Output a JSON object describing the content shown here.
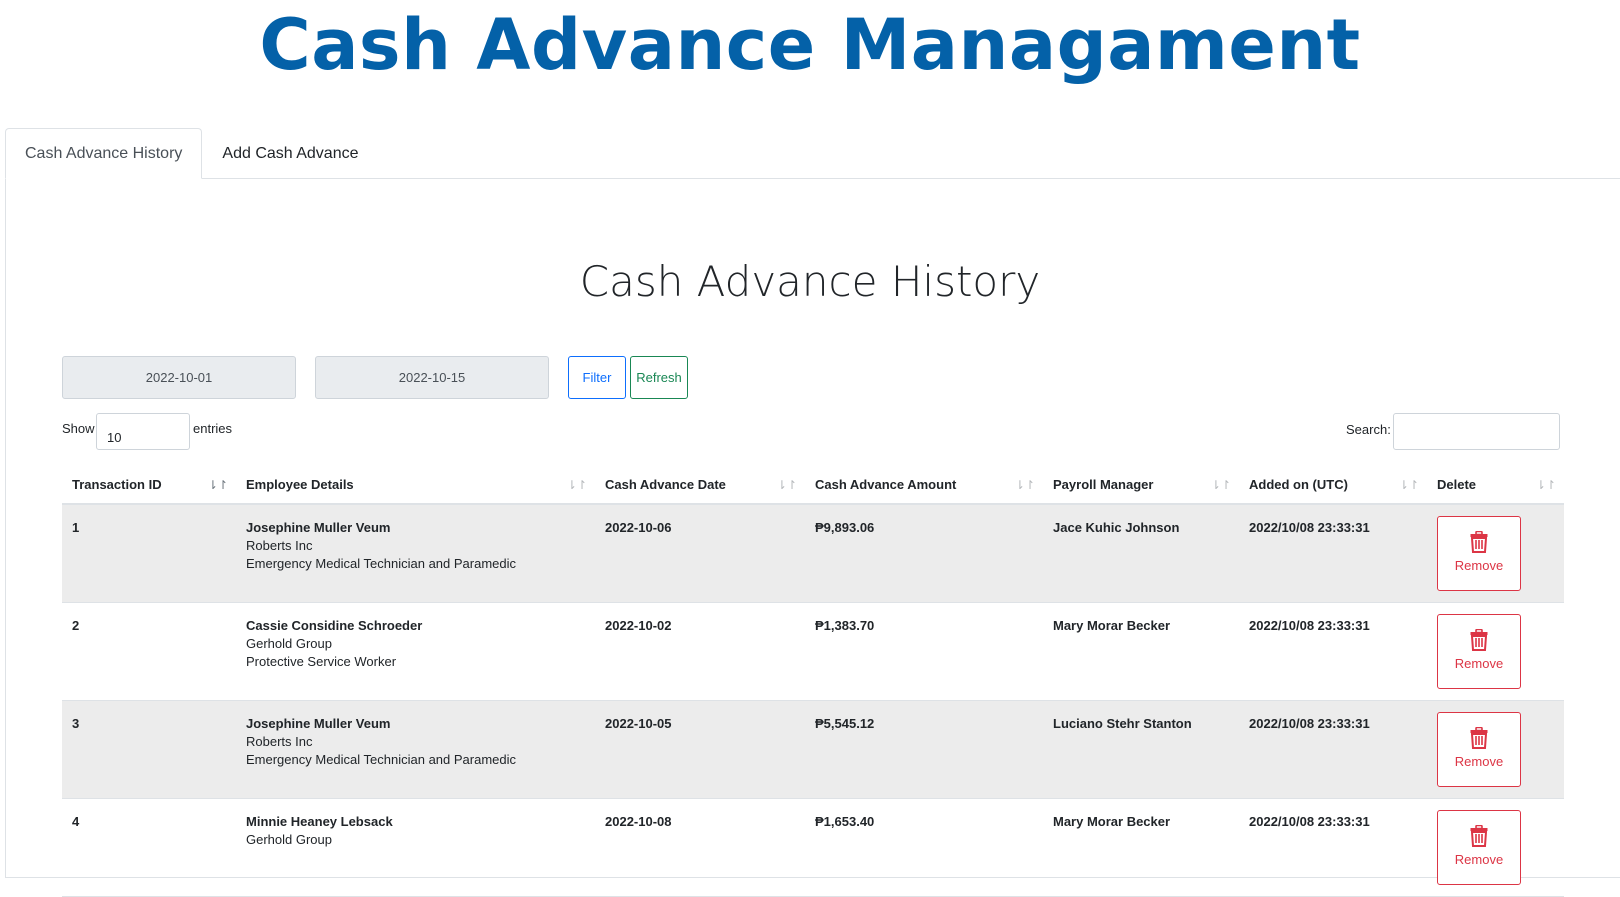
{
  "app_title": "Cash Advance Managament",
  "tabs": [
    {
      "label": "Cash Advance History",
      "active": true
    },
    {
      "label": "Add Cash Advance",
      "active": false
    }
  ],
  "section_title": "Cash Advance History",
  "filter": {
    "start_date": "2022-10-01",
    "end_date": "2022-10-15",
    "filter_label": "Filter",
    "refresh_label": "Refresh"
  },
  "length": {
    "show_label": "Show",
    "value": "10",
    "entries_label": "entries"
  },
  "search": {
    "label": "Search:",
    "value": ""
  },
  "table": {
    "columns": [
      "Transaction ID",
      "Employee Details",
      "Cash Advance Date",
      "Cash Advance Amount",
      "Payroll Manager",
      "Added on (UTC)",
      "Delete"
    ],
    "rows": [
      {
        "id": "1",
        "name": "Josephine Muller Veum",
        "company": "Roberts Inc",
        "position": "Emergency Medical Technician and Paramedic",
        "date": "2022-10-06",
        "amount": "₱9,893.06",
        "manager": "Jace Kuhic Johnson",
        "added": "2022/10/08 23:33:31",
        "remove_label": "Remove"
      },
      {
        "id": "2",
        "name": "Cassie Considine Schroeder",
        "company": "Gerhold Group",
        "position": "Protective Service Worker",
        "date": "2022-10-02",
        "amount": "₱1,383.70",
        "manager": "Mary Morar Becker",
        "added": "2022/10/08 23:33:31",
        "remove_label": "Remove"
      },
      {
        "id": "3",
        "name": "Josephine Muller Veum",
        "company": "Roberts Inc",
        "position": "Emergency Medical Technician and Paramedic",
        "date": "2022-10-05",
        "amount": "₱5,545.12",
        "manager": "Luciano Stehr Stanton",
        "added": "2022/10/08 23:33:31",
        "remove_label": "Remove"
      },
      {
        "id": "4",
        "name": "Minnie Heaney Lebsack",
        "company": "Gerhold Group",
        "position": "",
        "date": "2022-10-08",
        "amount": "₱1,653.40",
        "manager": "Mary Morar Becker",
        "added": "2022/10/08 23:33:31",
        "remove_label": "Remove"
      }
    ]
  },
  "colors": {
    "title": "#0461a8",
    "danger": "#dc3545",
    "primary": "#0d6efd",
    "success": "#198754",
    "row_stripe": "#ececec"
  }
}
